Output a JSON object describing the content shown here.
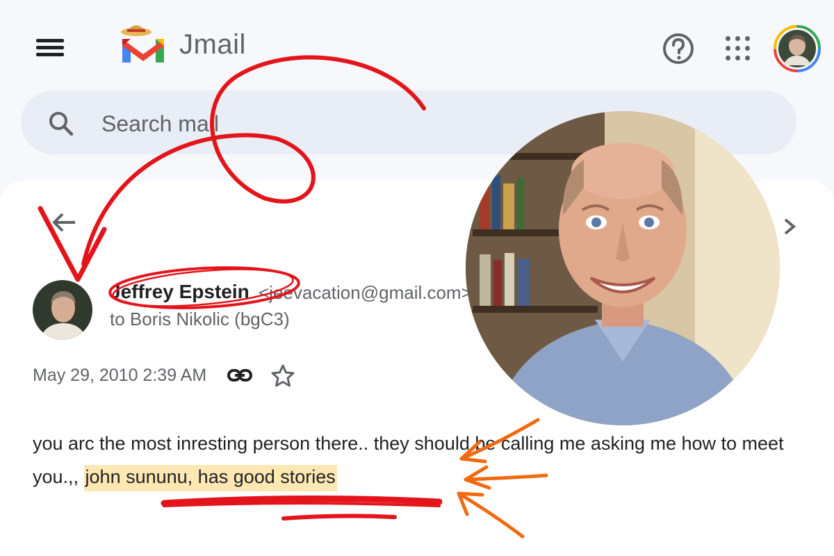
{
  "header": {
    "brand": "Jmail",
    "menu_icon": "hamburger-menu-icon",
    "help_icon": "help-circle-icon",
    "apps_icon": "apps-grid-icon"
  },
  "search": {
    "placeholder": "Search mail"
  },
  "email": {
    "sender_name": "Jeffrey Epstein",
    "sender_email": "<jeevacation@gmail.com>",
    "recipient": "to Boris Nikolic (bgC3)",
    "date": "May 29, 2010 2:39 AM",
    "body_before": "you arc the most inresting person there.. they should be calling me asking me how to meet you.,, ",
    "body_highlight": "john sununu, has good stories"
  },
  "colors": {
    "annotation_red": "#e4141b",
    "annotation_orange": "#f06a10",
    "highlight": "#fde7b3"
  }
}
